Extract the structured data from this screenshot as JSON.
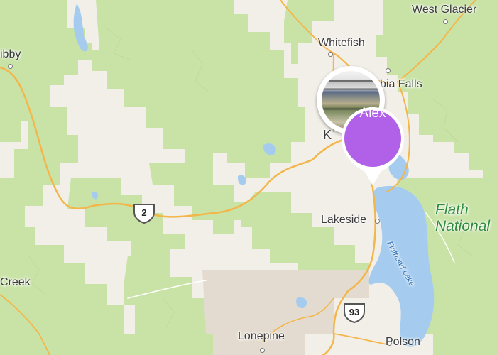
{
  "map": {
    "places": {
      "west_glacier": "West Glacier",
      "whitefish": "Whitefish",
      "columbia_falls": "bia Falls",
      "libby": "ibby",
      "kalispell": "K",
      "lakeside": "Lakeside",
      "lonepine": "Lonepine",
      "polson": "Polson",
      "creek": "Creek"
    },
    "park_label": "Flath\nNational",
    "lake_label": "Flathead Lake",
    "routes": {
      "us2": "2",
      "us93": "93"
    }
  },
  "markers": {
    "photo": {
      "description_icon": "photo-thumbnail"
    },
    "alex": {
      "name": "Alex",
      "color": "#b061e8"
    }
  },
  "colors": {
    "forest": "#c8e2a6",
    "clear": "#f2efe9",
    "water": "#a0caef",
    "road": "#f2b84b",
    "desert": "#e3dcd1"
  }
}
